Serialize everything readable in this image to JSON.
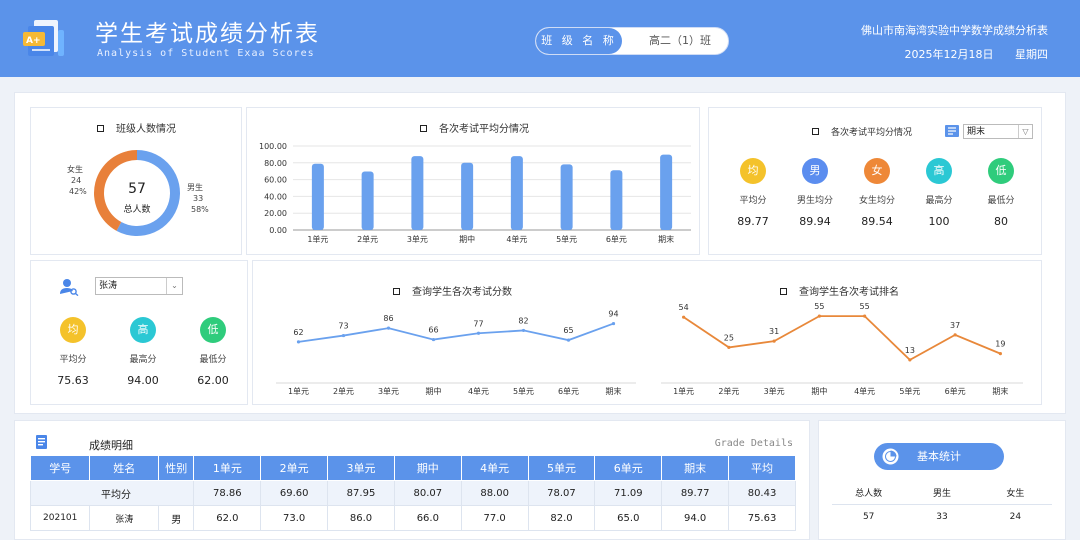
{
  "header": {
    "title": "学生考试成绩分析表",
    "subtitle": "Analysis of Student Exaa Scores",
    "class_label": "班 级 名 称",
    "class_value": "高二（1）班",
    "school": "佛山市南海湾实验中学数学成绩分析表",
    "date": "2025年12月18日",
    "weekday": "星期四"
  },
  "class_panel": {
    "title": "班级人数情况",
    "total": "57",
    "total_label": "总人数",
    "female": {
      "label": "女生",
      "count": "24",
      "pct": "42%",
      "value": 24,
      "color": "#e8803a"
    },
    "male": {
      "label": "男生",
      "count": "33",
      "pct": "58%",
      "value": 33,
      "color": "#6aa1ee"
    }
  },
  "avg_chart_title": "各次考试平均分情况",
  "stats_panel": {
    "title": "各次考试平均分情况",
    "exam_select": "期末",
    "items": [
      {
        "icon": "均",
        "label": "平均分",
        "value": "89.77",
        "color": "#f4c22b"
      },
      {
        "icon": "男",
        "label": "男生均分",
        "value": "89.94",
        "color": "#5b8def"
      },
      {
        "icon": "女",
        "label": "女生均分",
        "value": "89.54",
        "color": "#ee8838"
      },
      {
        "icon": "高",
        "label": "最高分",
        "value": "100",
        "color": "#2bc8d4"
      },
      {
        "icon": "低",
        "label": "最低分",
        "value": "80",
        "color": "#2fcc7c"
      }
    ]
  },
  "student_panel": {
    "student_select": "张涛",
    "items": [
      {
        "icon": "均",
        "label": "平均分",
        "value": "75.63",
        "color": "#f4c22b"
      },
      {
        "icon": "高",
        "label": "最高分",
        "value": "94.00",
        "color": "#2bc8d4"
      },
      {
        "icon": "低",
        "label": "最低分",
        "value": "62.00",
        "color": "#2fcc7c"
      }
    ]
  },
  "score_chart_title": "查询学生各次考试分数",
  "rank_chart_title": "查询学生各次考试排名",
  "chart_data": [
    {
      "type": "bar",
      "categories": [
        "1单元",
        "2单元",
        "3单元",
        "期中",
        "4单元",
        "5单元",
        "6单元",
        "期末"
      ],
      "values": [
        78.86,
        69.6,
        87.95,
        80.07,
        88.0,
        78.07,
        71.09,
        89.77
      ],
      "ylim": [
        0,
        100
      ],
      "yticks": [
        "0.00",
        "20.00",
        "40.00",
        "60.00",
        "80.00",
        "100.00"
      ],
      "color": "#6aa1ee"
    },
    {
      "type": "line",
      "categories": [
        "1单元",
        "2单元",
        "3单元",
        "期中",
        "4单元",
        "5单元",
        "6单元",
        "期末"
      ],
      "values": [
        62,
        73,
        86,
        66,
        77,
        82,
        65,
        94
      ],
      "color": "#6aa1ee"
    },
    {
      "type": "line",
      "categories": [
        "1单元",
        "2单元",
        "3单元",
        "期中",
        "4单元",
        "5单元",
        "6单元",
        "期末"
      ],
      "values": [
        54,
        25,
        31,
        55,
        55,
        13,
        37,
        19
      ],
      "color": "#e8883a"
    }
  ],
  "details": {
    "title": "成绩明细",
    "title_en": "Grade Details",
    "columns": [
      "学号",
      "姓名",
      "性别",
      "1单元",
      "2单元",
      "3单元",
      "期中",
      "4单元",
      "5单元",
      "6单元",
      "期末",
      "平均"
    ],
    "avg_row": {
      "label": "平均分",
      "values": [
        "78.86",
        "69.60",
        "87.95",
        "80.07",
        "88.00",
        "78.07",
        "71.09",
        "89.77",
        "80.43"
      ]
    },
    "rows": [
      [
        "202101",
        "张涛",
        "男",
        "62.0",
        "73.0",
        "86.0",
        "66.0",
        "77.0",
        "82.0",
        "65.0",
        "94.0",
        "75.63"
      ]
    ]
  },
  "basic_stats": {
    "button": "基本统计",
    "columns": [
      "总人数",
      "男生",
      "女生"
    ],
    "values": [
      "57",
      "33",
      "24"
    ]
  }
}
